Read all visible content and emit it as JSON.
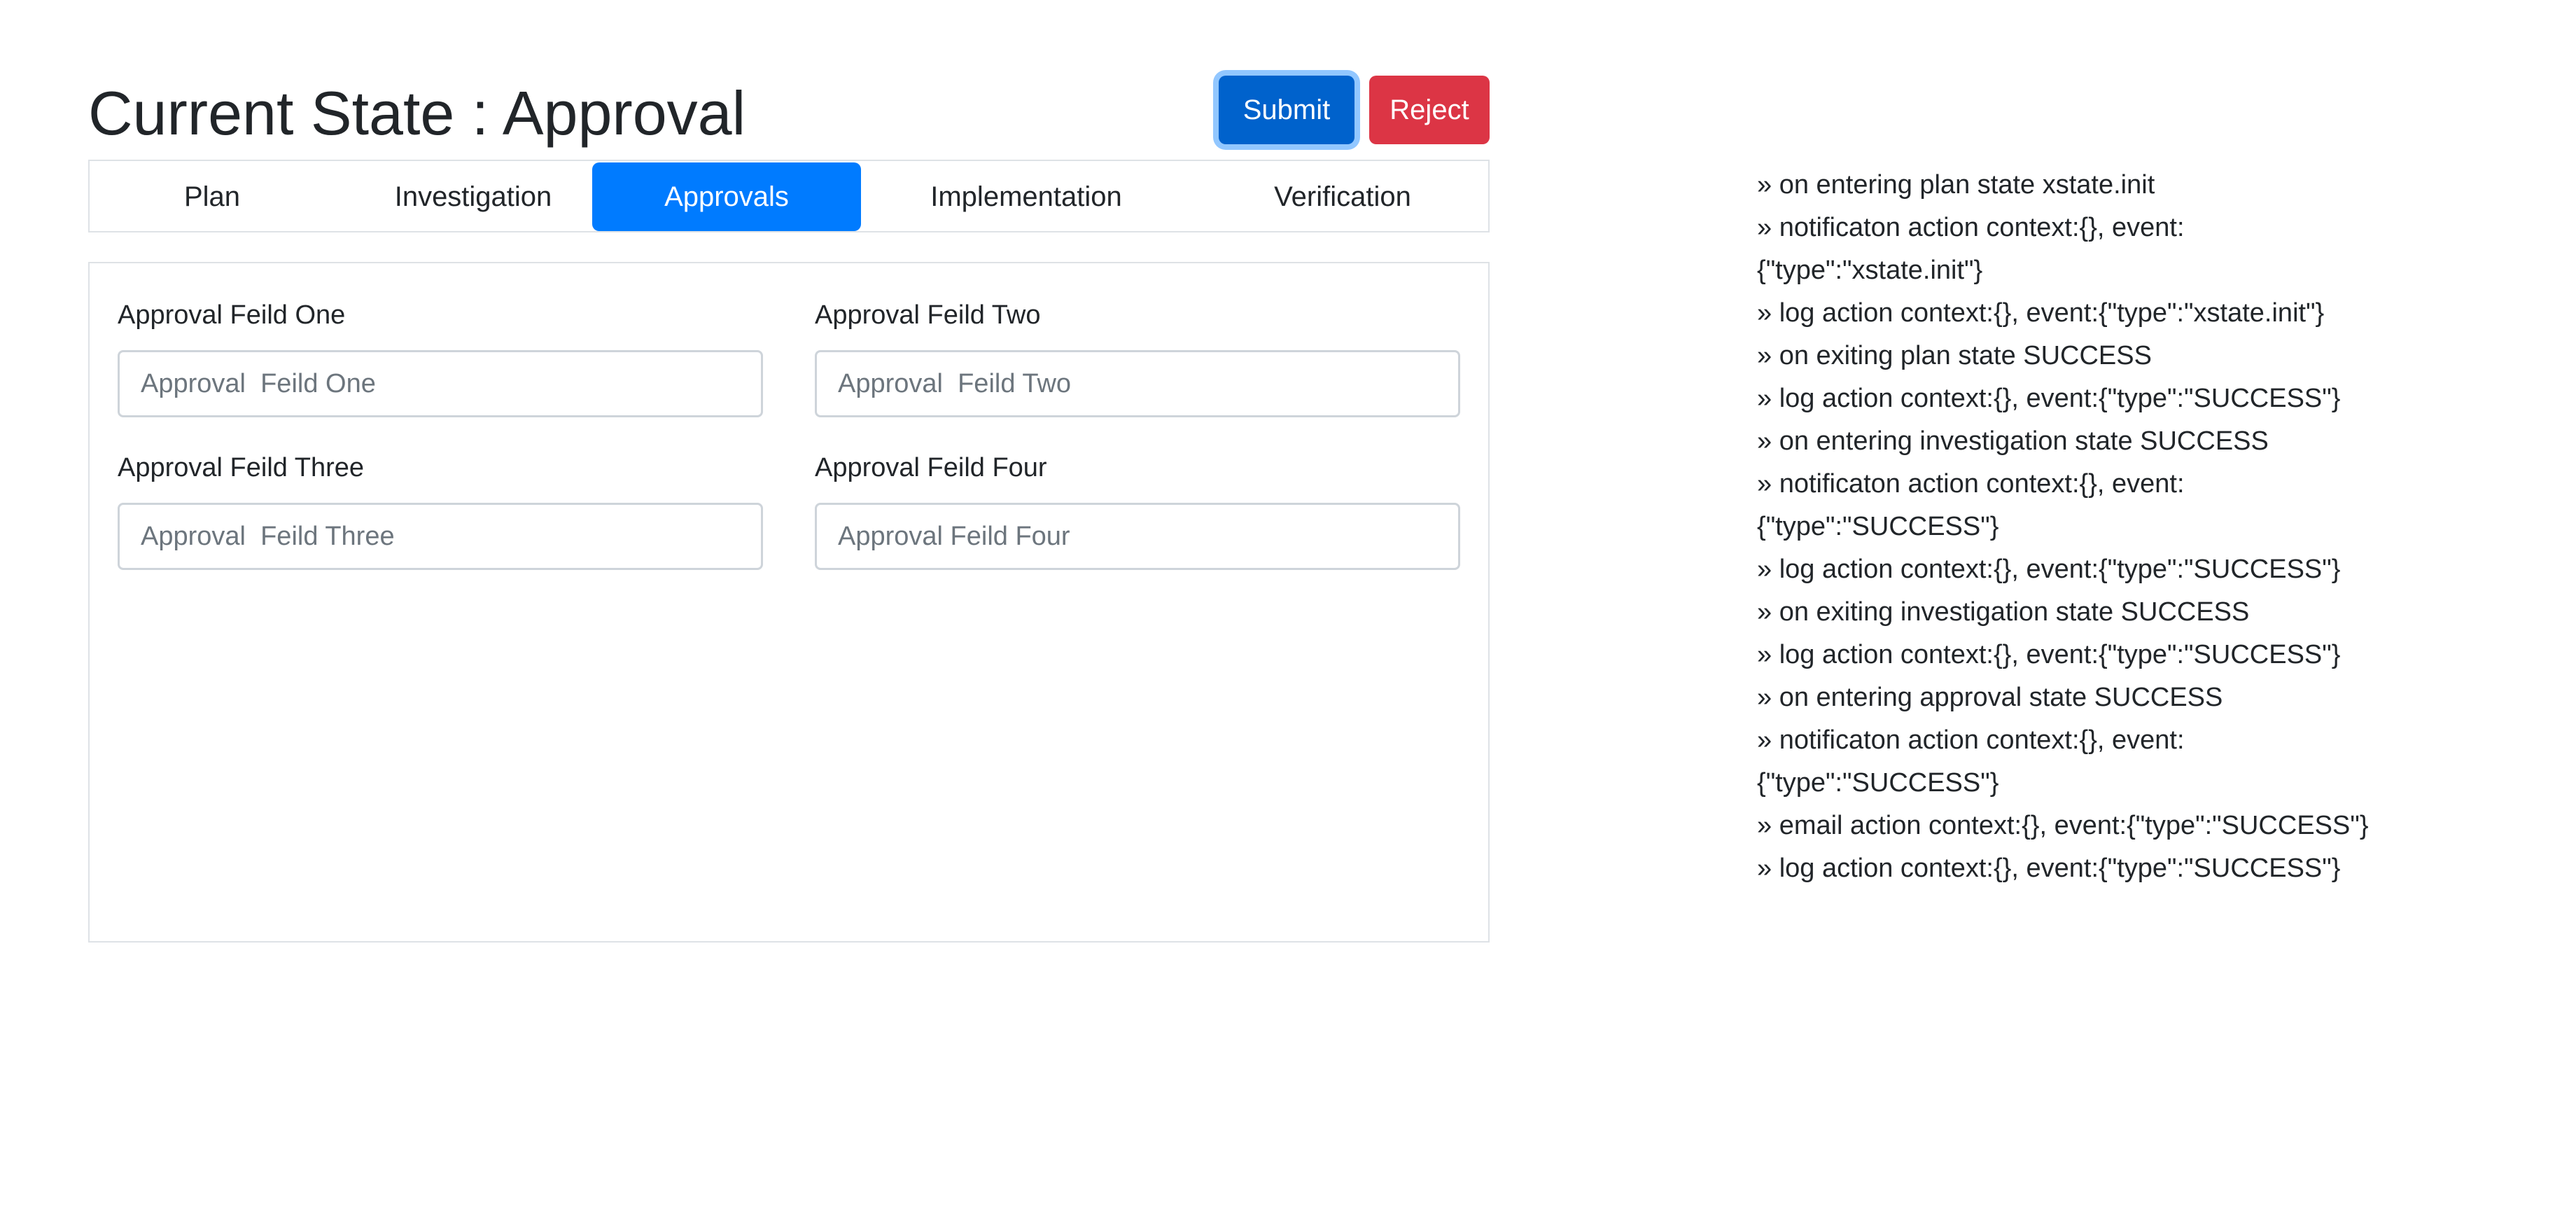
{
  "header": {
    "title": "Current State : Approval",
    "submit_label": "Submit",
    "reject_label": "Reject"
  },
  "tabs": [
    {
      "label": "Plan",
      "active": false
    },
    {
      "label": "Investigation",
      "active": false
    },
    {
      "label": "Approvals",
      "active": true
    },
    {
      "label": "Implementation",
      "active": false
    },
    {
      "label": "Verification",
      "active": false
    }
  ],
  "form": {
    "fields": [
      {
        "label": "Approval Feild One",
        "placeholder": "Approval  Feild One",
        "value": ""
      },
      {
        "label": "Approval Feild Two",
        "placeholder": "Approval  Feild Two",
        "value": ""
      },
      {
        "label": "Approval Feild Three",
        "placeholder": "Approval  Feild Three",
        "value": ""
      },
      {
        "label": "Approval Feild Four",
        "placeholder": "Approval Feild Four",
        "value": ""
      }
    ]
  },
  "log": [
    "» on entering plan state xstate.init",
    "» notificaton action context:{}, event:",
    "{\"type\":\"xstate.init\"}",
    "» log action context:{}, event:{\"type\":\"xstate.init\"}",
    "» on exiting plan state SUCCESS",
    "» log action context:{}, event:{\"type\":\"SUCCESS\"}",
    "» on entering investigation state SUCCESS",
    "» notificaton action context:{}, event:",
    "{\"type\":\"SUCCESS\"}",
    "» log action context:{}, event:{\"type\":\"SUCCESS\"}",
    "» on exiting investigation state SUCCESS",
    "» log action context:{}, event:{\"type\":\"SUCCESS\"}",
    "» on entering approval state SUCCESS",
    "» notificaton action context:{}, event:",
    "{\"type\":\"SUCCESS\"}",
    "» email action context:{}, event:{\"type\":\"SUCCESS\"}",
    "» log action context:{}, event:{\"type\":\"SUCCESS\"}"
  ],
  "colors": {
    "primary": "#007bff",
    "submit": "#0062cc",
    "danger": "#dc3545",
    "border": "#dee2e6"
  }
}
